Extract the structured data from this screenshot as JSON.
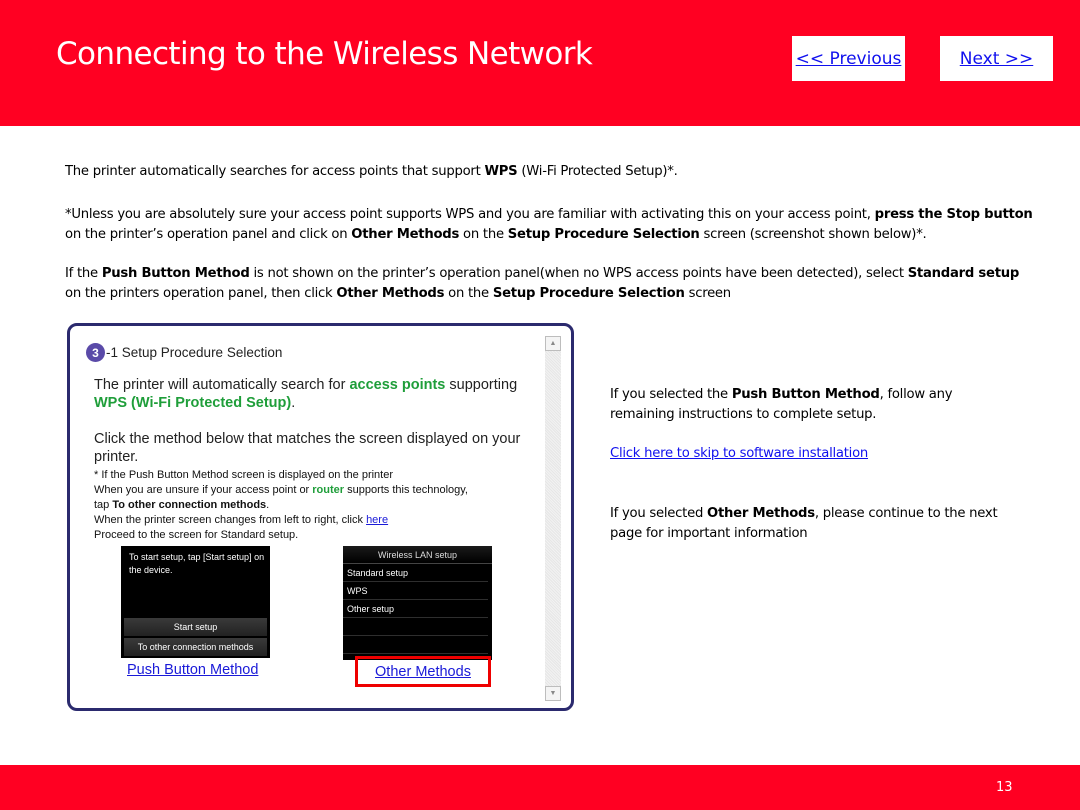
{
  "header": {
    "title": "Connecting to the Wireless Network",
    "prev_label": "<< Previous",
    "next_label": "Next >>"
  },
  "colors": {
    "brand_red": "#ff0022",
    "link_blue": "#1010ee",
    "highlight_green": "#1f9e3a",
    "frame_navy": "#2b2a6e"
  },
  "intro": {
    "p1": [
      "The  printer automatically searches for access points that support ",
      "WPS",
      " (Wi-Fi Protected Setup)*."
    ],
    "p2": [
      "*Unless you are absolutely sure your access point supports WPS and you are familiar with activating  this on your access point, ",
      "press the Stop button",
      " on the printer’s operation panel and click on  ",
      "Other Methods",
      " on the ",
      "Setup Procedure Selection",
      " screen (screenshot shown below)*."
    ],
    "p3": [
      "If the ",
      "Push Button Method",
      " is not shown  on the printer’s operation panel(when no WPS access points have been detected), select ",
      "Standard setup",
      " on the printers operation panel, then click ",
      "Other Methods",
      " on the ",
      "Setup Procedure Selection",
      " screen"
    ]
  },
  "screenshot": {
    "step_number": "3",
    "step_title": "-1 Setup Procedure Selection",
    "line1": [
      "The printer will automatically search for ",
      "access points",
      " supporting ",
      "WPS (Wi-Fi Protected Setup)",
      "."
    ],
    "line2": "Click the method below that matches the screen displayed on your printer.",
    "note1": "* If the Push Button Method screen is displayed on the printer",
    "note2": [
      "When you are unsure if your access point or ",
      "router",
      " supports this technology,"
    ],
    "note3": [
      "tap ",
      "To other connection methods",
      "."
    ],
    "note4": [
      "When the printer screen changes from left to right, click ",
      "here"
    ],
    "note5": "Proceed to the screen for Standard setup.",
    "push_screen": {
      "message": "To start setup, tap [Start setup] on the device.",
      "btn1": "Start setup",
      "btn2": "To other connection methods"
    },
    "other_screen": {
      "title": "Wireless LAN setup",
      "items": [
        "Standard setup",
        "WPS",
        "Other setup",
        "",
        ""
      ]
    },
    "push_link": "Push Button Method",
    "other_link": "Other Methods",
    "scroll_up": "▲",
    "scroll_down": "▼"
  },
  "side": {
    "p1": [
      "If you selected the ",
      "Push Button Method",
      ", follow any remaining instructions to complete setup."
    ],
    "link": "Click here to skip to software installation",
    "p2": [
      "If you selected ",
      "Other Methods",
      ", please continue to the next page  for important information"
    ]
  },
  "footer": {
    "page_number": "13"
  }
}
